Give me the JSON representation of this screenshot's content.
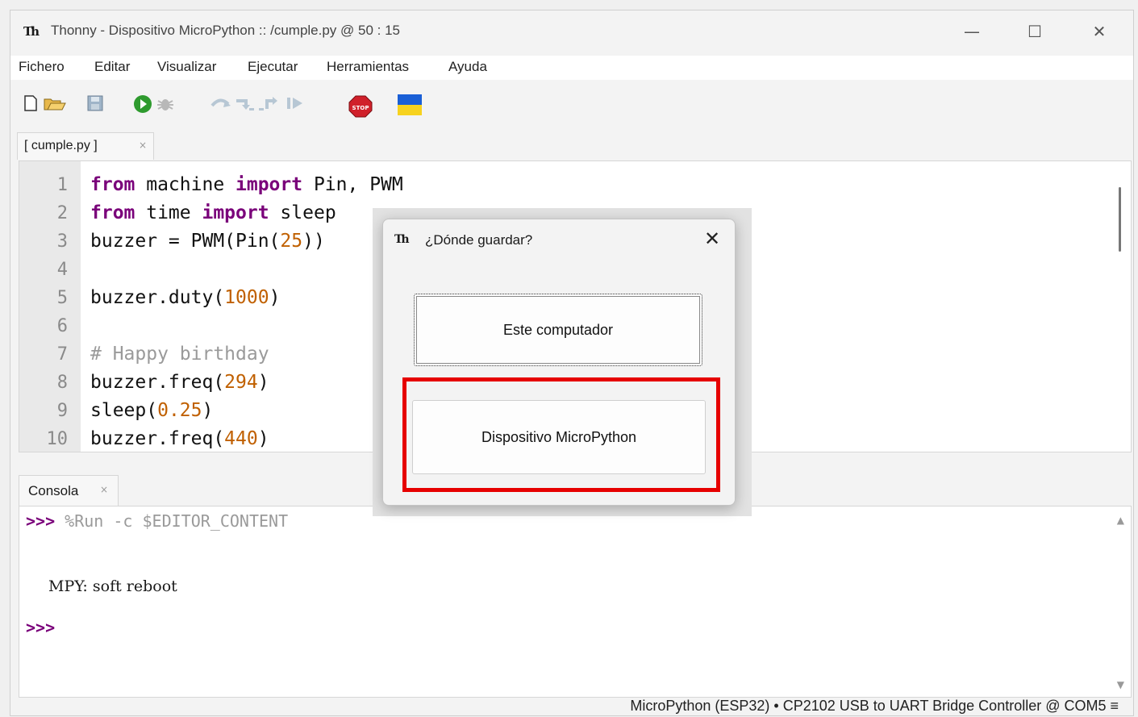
{
  "window": {
    "title": "Thonny  -  Dispositivo MicroPython :: /cumple.py  @  50 : 15",
    "app_icon": "Th",
    "minimize": "—",
    "maximize": "☐",
    "close": "✕"
  },
  "menu": [
    "Fichero",
    "Editar",
    "Visualizar",
    "Ejecutar",
    "Herramientas",
    "Ayuda"
  ],
  "toolbar": {
    "icons": [
      "new-file-icon",
      "open-file-icon",
      "save-icon",
      "run-icon",
      "debug-icon",
      "step-over-icon",
      "step-into-icon",
      "step-out-icon",
      "resume-icon",
      "stop-icon",
      "ukraine-flag-icon"
    ],
    "stop_label": "STOP"
  },
  "editor": {
    "tab_label": "[ cumple.py ]",
    "tab_close": "×",
    "line_numbers": [
      "1",
      "2",
      "3",
      "4",
      "5",
      "6",
      "7",
      "8",
      "9",
      "10"
    ]
  },
  "code_lines": [
    [
      [
        "kw",
        "from"
      ],
      [
        "t",
        " machine "
      ],
      [
        "kw",
        "import"
      ],
      [
        "t",
        " Pin, PWM"
      ]
    ],
    [
      [
        "kw",
        "from"
      ],
      [
        "t",
        " time "
      ],
      [
        "kw",
        "import"
      ],
      [
        "t",
        " sleep"
      ]
    ],
    [
      [
        "t",
        "buzzer = PWM(Pin("
      ],
      [
        "num",
        "25"
      ],
      [
        "t",
        "))"
      ]
    ],
    [],
    [
      [
        "t",
        "buzzer.duty("
      ],
      [
        "num",
        "1000"
      ],
      [
        "t",
        ")"
      ]
    ],
    [],
    [
      [
        "cmt",
        "# Happy birthday"
      ]
    ],
    [
      [
        "t",
        "buzzer.freq("
      ],
      [
        "num",
        "294"
      ],
      [
        "t",
        ")"
      ]
    ],
    [
      [
        "t",
        "sleep("
      ],
      [
        "num",
        "0.25"
      ],
      [
        "t",
        ")"
      ]
    ],
    [
      [
        "t",
        "buzzer.freq("
      ],
      [
        "num",
        "440"
      ],
      [
        "t",
        ")"
      ]
    ]
  ],
  "console": {
    "tab_label": "Consola",
    "tab_close": "×",
    "prompt": ">>>",
    "command": " %Run -c $EDITOR_CONTENT",
    "output": "MPY: soft reboot",
    "scroll_up": "▲",
    "scroll_down": "▼"
  },
  "status": {
    "text": "MicroPython (ESP32)  •  CP2102 USB to UART Bridge Controller @ COM5  ≡"
  },
  "dialog": {
    "icon": "Th",
    "title": "¿Dónde guardar?",
    "close": "✕",
    "option_local": "Este computador",
    "option_device": "Dispositivo MicroPython"
  }
}
